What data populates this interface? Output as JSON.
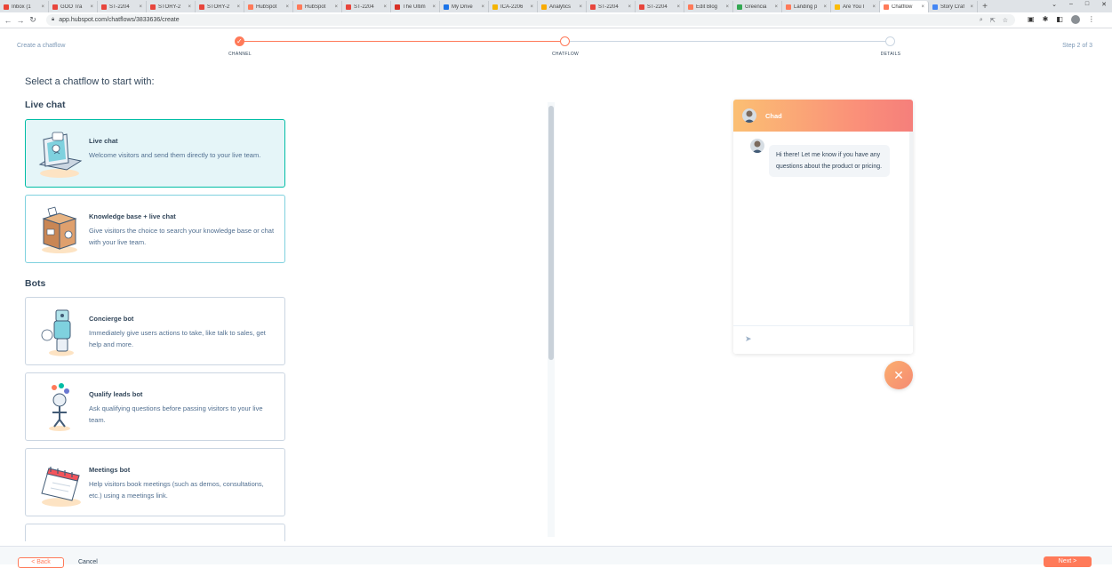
{
  "browser": {
    "tabs": [
      {
        "label": "Inbox (1",
        "color": "#ea4335"
      },
      {
        "label": "GOO Tra",
        "color": "#e8453c"
      },
      {
        "label": "ST-2204",
        "color": "#e8453c"
      },
      {
        "label": "STORY-2",
        "color": "#e8453c"
      },
      {
        "label": "STORY-2",
        "color": "#e8453c"
      },
      {
        "label": "HubSpot",
        "color": "#ff7a59"
      },
      {
        "label": "HubSpot",
        "color": "#ff7a59"
      },
      {
        "label": "ST-2204",
        "color": "#e8453c"
      },
      {
        "label": "The Ultim",
        "color": "#d93025"
      },
      {
        "label": "My Drive",
        "color": "#1a73e8"
      },
      {
        "label": "ICA-2206",
        "color": "#f4b400"
      },
      {
        "label": "Analytics",
        "color": "#f9ab00"
      },
      {
        "label": "ST-2204",
        "color": "#e8453c"
      },
      {
        "label": "ST-2204",
        "color": "#e8453c"
      },
      {
        "label": "Edit Blog",
        "color": "#ff7a59"
      },
      {
        "label": "Greencia",
        "color": "#34a853"
      },
      {
        "label": "Landing p",
        "color": "#ff7a59"
      },
      {
        "label": "Are You I",
        "color": "#fbbc04"
      },
      {
        "label": "Chatflow",
        "color": "#ff7a59"
      },
      {
        "label": "Story Craf",
        "color": "#4285f4"
      }
    ],
    "active_tab": 18,
    "new_tab": "+",
    "window_controls": [
      "⌄",
      "–",
      "□",
      "✕"
    ],
    "url": "app.hubspot.com/chatflows/3833636/create"
  },
  "wizard": {
    "title": "Create a chatflow",
    "steps": [
      "CHANNEL",
      "CHATFLOW",
      "DETAILS"
    ],
    "current_step": 2,
    "step_count": "Step 2 of 3"
  },
  "left": {
    "heading": "Select a chatflow to start with:",
    "sections": {
      "live_chat": "Live chat",
      "bots": "Bots"
    },
    "cards": [
      {
        "title": "Live chat",
        "desc": "Welcome visitors and send them directly to your live team."
      },
      {
        "title": "Knowledge base + live chat",
        "desc": "Give visitors the choice to search your knowledge base or chat with your live team."
      },
      {
        "title": "Concierge bot",
        "desc": "Immediately give users actions to take, like talk to sales, get help and more."
      },
      {
        "title": "Qualify leads bot",
        "desc": "Ask qualifying questions before passing visitors to your live team."
      },
      {
        "title": "Meetings bot",
        "desc": "Help visitors book meetings (such as demos, consultations, etc.) using a meetings link."
      }
    ]
  },
  "preview": {
    "agent_name": "Chad",
    "message": "Hi there! Let me know if you have any questions about the product or pricing."
  },
  "footer": {
    "back": "< Back",
    "cancel": "Cancel",
    "next": "Next >"
  },
  "colors": {
    "accent": "#ff7a59",
    "selected_bg": "#e5f5f8",
    "selected_border": "#00bda5"
  }
}
